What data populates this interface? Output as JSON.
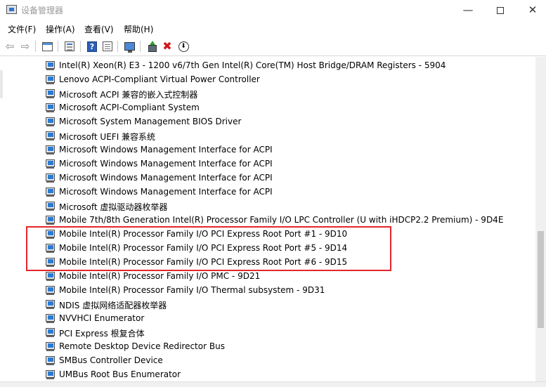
{
  "window": {
    "title": "设备管理器",
    "minimize_glyph": "—",
    "close_glyph": "✕"
  },
  "menu": [
    {
      "label": "文件(F)"
    },
    {
      "label": "操作(A)"
    },
    {
      "label": "查看(V)"
    },
    {
      "label": "帮助(H)"
    }
  ],
  "toolbar": {
    "back_glyph": "⇦",
    "forward_glyph": "⇨",
    "help_glyph": "?",
    "uninstall_glyph": "✖",
    "update_glyph": "⬇"
  },
  "devices": [
    {
      "label": "Intel(R) Xeon(R) E3 - 1200 v6/7th Gen Intel(R) Core(TM) Host Bridge/DRAM Registers - 5904"
    },
    {
      "label": "Lenovo ACPI-Compliant Virtual Power Controller"
    },
    {
      "label": "Microsoft ACPI 兼容的嵌入式控制器"
    },
    {
      "label": "Microsoft ACPI-Compliant System"
    },
    {
      "label": "Microsoft System Management BIOS Driver"
    },
    {
      "label": "Microsoft UEFI 兼容系统"
    },
    {
      "label": "Microsoft Windows Management Interface for ACPI"
    },
    {
      "label": "Microsoft Windows Management Interface for ACPI"
    },
    {
      "label": "Microsoft Windows Management Interface for ACPI"
    },
    {
      "label": "Microsoft Windows Management Interface for ACPI"
    },
    {
      "label": "Microsoft 虚拟驱动器枚举器"
    },
    {
      "label": "Mobile 7th/8th Generation Intel(R) Processor Family I/O LPC Controller (U with iHDCP2.2 Premium) - 9D4E"
    },
    {
      "label": "Mobile Intel(R) Processor Family I/O PCI Express Root Port #1 - 9D10"
    },
    {
      "label": "Mobile Intel(R) Processor Family I/O PCI Express Root Port #5 - 9D14"
    },
    {
      "label": "Mobile Intel(R) Processor Family I/O PCI Express Root Port #6 - 9D15"
    },
    {
      "label": "Mobile Intel(R) Processor Family I/O PMC - 9D21"
    },
    {
      "label": "Mobile Intel(R) Processor Family I/O Thermal subsystem - 9D31"
    },
    {
      "label": "NDIS 虚拟网络适配器枚举器"
    },
    {
      "label": "NVVHCI Enumerator"
    },
    {
      "label": "PCI Express 根复合体"
    },
    {
      "label": "Remote Desktop Device Redirector Bus"
    },
    {
      "label": "SMBus Controller Device"
    },
    {
      "label": "UMBus Root Bus Enumerator"
    }
  ],
  "colors": {
    "highlight_border": "#e3262b",
    "device_icon_screen": "#2a7bd3",
    "help_icon": "#2b5fb6",
    "uninstall_x": "#d4161c"
  }
}
